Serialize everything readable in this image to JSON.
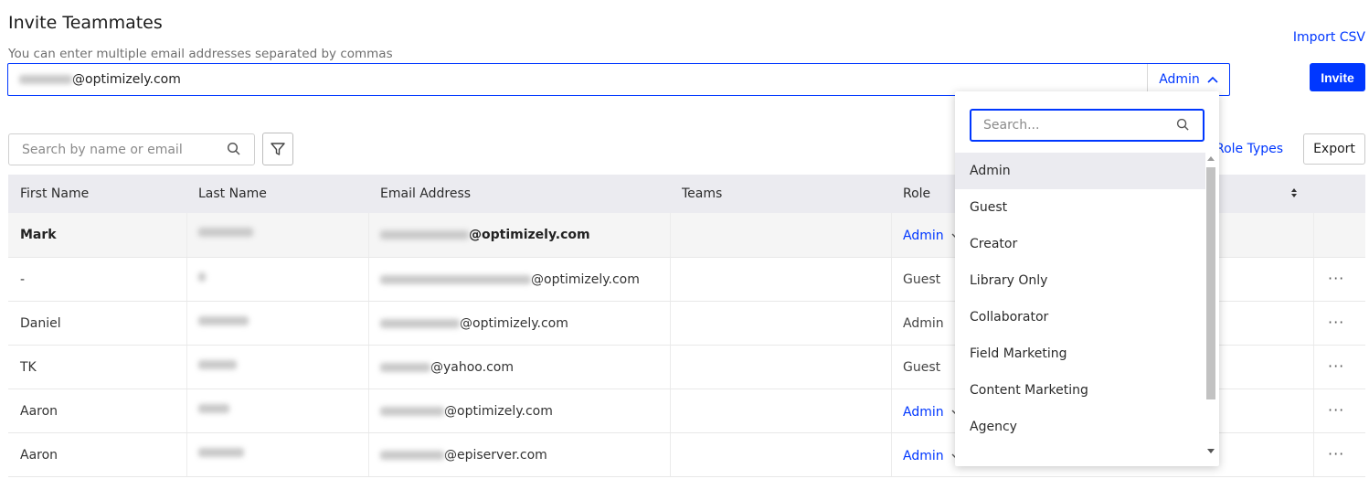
{
  "header": {
    "title": "Invite Teammates",
    "hint": "You can enter multiple email addresses separated by commas",
    "import_csv": "Import CSV"
  },
  "invite": {
    "email_suffix": "@optimizely.com",
    "role": "Admin",
    "button": "Invite"
  },
  "toolbar": {
    "search_placeholder": "Search by name or email",
    "role_types": "Role Types",
    "export": "Export"
  },
  "table": {
    "columns": [
      "First Name",
      "Last Name",
      "Email Address",
      "Teams",
      "Role"
    ],
    "rows": [
      {
        "first": "Mark",
        "email_suffix": "@optimizely.com",
        "role": "Admin",
        "role_editable": true
      },
      {
        "first": "-",
        "email_suffix": "@optimizely.com",
        "role": "Guest",
        "role_editable": false
      },
      {
        "first": "Daniel",
        "email_suffix": "@optimizely.com",
        "role": "Admin",
        "role_editable": false
      },
      {
        "first": "TK",
        "email_suffix": "@yahoo.com",
        "role": "Guest",
        "role_editable": false
      },
      {
        "first": "Aaron",
        "email_suffix": "@optimizely.com",
        "role": "Admin",
        "role_editable": true
      },
      {
        "first": "Aaron",
        "email_suffix": "@episerver.com",
        "role": "Admin",
        "role_editable": true
      }
    ]
  },
  "role_dropdown": {
    "search_placeholder": "Search...",
    "options": [
      "Admin",
      "Guest",
      "Creator",
      "Library Only",
      "Collaborator",
      "Field Marketing",
      "Content Marketing",
      "Agency"
    ],
    "selected": "Admin"
  },
  "icons": {
    "search": "search-icon",
    "filter": "filter-icon",
    "chevron_up": "chevron-up-icon",
    "chevron_down": "chevron-down-icon",
    "sort": "sort-icon",
    "more": "more-icon"
  },
  "colors": {
    "accent": "#0037ff",
    "header_bg": "#ebebf0"
  }
}
